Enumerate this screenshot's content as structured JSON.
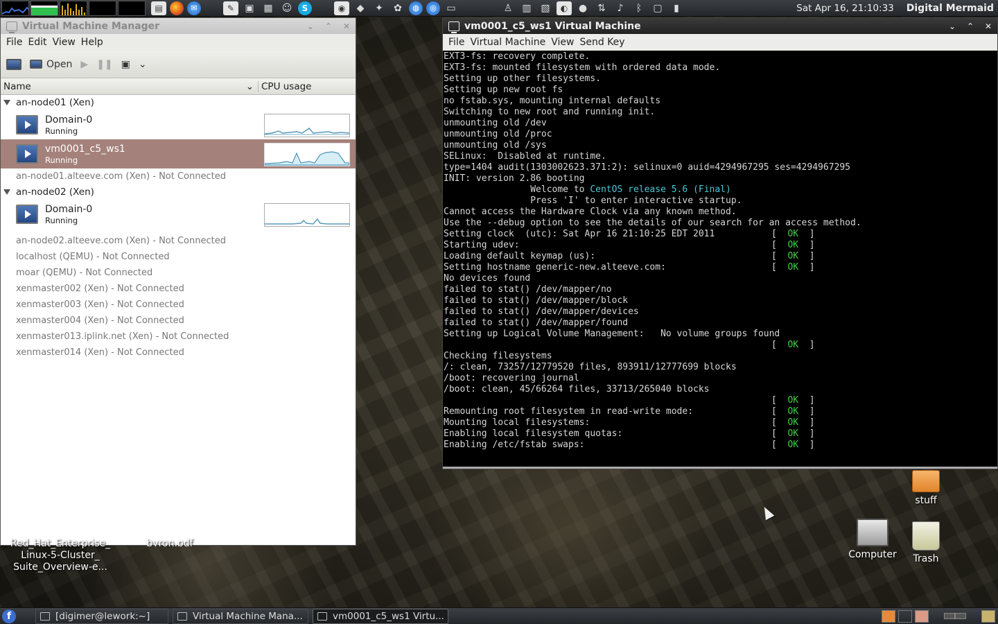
{
  "top_panel": {
    "clock": "Sat Apr 16, 21:10:33",
    "user": "Digital Mermaid",
    "launchers": [
      "terminal-icon",
      "firefox-icon",
      "thunderbird-icon",
      "text-editor-icon",
      "console-icon",
      "calculator-icon",
      "pidgin-icon",
      "skype-icon"
    ],
    "tray": [
      "volume-icon",
      "bluetooth-icon",
      "network-icon",
      "battery-icon"
    ]
  },
  "vmm": {
    "title": "Virtual Machine Manager",
    "menu": [
      "File",
      "Edit",
      "View",
      "Help"
    ],
    "toolbar": {
      "open_label": "Open"
    },
    "columns": {
      "name": "Name",
      "cpu": "CPU usage"
    },
    "hosts": [
      {
        "label": "an-node01 (Xen)",
        "vms": [
          {
            "name": "Domain-0",
            "status": "Running",
            "selected": false
          },
          {
            "name": "vm0001_c5_ws1",
            "status": "Running",
            "selected": true
          }
        ]
      },
      {
        "label": "an-node02 (Xen)",
        "vms": [
          {
            "name": "Domain-0",
            "status": "Running",
            "selected": false
          }
        ]
      }
    ],
    "conn_after_node01": "an-node01.alteeve.com (Xen) - Not Connected",
    "connections": [
      "an-node02.alteeve.com (Xen) - Not Connected",
      "localhost (QEMU) - Not Connected",
      "moar (QEMU) - Not Connected",
      "xenmaster002 (Xen) - Not Connected",
      "xenmaster003 (Xen) - Not Connected",
      "xenmaster004 (Xen) - Not Connected",
      "xenmaster013.iplink.net (Xen) - Not Connected",
      "xenmaster014 (Xen) - Not Connected"
    ]
  },
  "vm_console": {
    "title": "vm0001_c5_ws1 Virtual Machine",
    "menu": [
      "File",
      "Virtual Machine",
      "View",
      "Send Key"
    ],
    "lines": [
      "EXT3-fs: recovery complete.",
      "EXT3-fs: mounted filesystem with ordered data mode.",
      "Setting up other filesystems.",
      "Setting up new root fs",
      "no fstab.sys, mounting internal defaults",
      "Switching to new root and running init.",
      "unmounting old /dev",
      "unmounting old /proc",
      "unmounting old /sys",
      "SELinux:  Disabled at runtime.",
      "type=1404 audit(1303002623.371:2): selinux=0 auid=4294967295 ses=4294967295",
      "INIT: version 2.86 booting",
      "                Welcome to ",
      "                Press 'I' to enter interactive startup.",
      "Cannot access the Hardware Clock via any known method.",
      "Use the --debug option to see the details of our search for an access method.",
      "Setting clock  (utc): Sat Apr 16 21:10:25 EDT 2011",
      "Starting udev:",
      "Loading default keymap (us):",
      "Setting hostname generic-new.alteeve.com:",
      "No devices found",
      "failed to stat() /dev/mapper/no",
      "failed to stat() /dev/mapper/block",
      "failed to stat() /dev/mapper/devices",
      "failed to stat() /dev/mapper/found",
      "Setting up Logical Volume Management:   No volume groups found",
      "",
      "Checking filesystems",
      "/: clean, 73257/12779520 files, 893911/12777699 blocks",
      "/boot: recovering journal",
      "/boot: clean, 45/66264 files, 33713/265040 blocks",
      "",
      "Remounting root filesystem in read-write mode:",
      "Mounting local filesystems:",
      "Enabling local filesystem quotas:",
      "Enabling /etc/fstab swaps:",
      "",
      "_"
    ],
    "highlight": "CentOS release 5.6 (Final)",
    "ok_text": "OK",
    "ok_line_indices": [
      16,
      17,
      18,
      19,
      26,
      31,
      32,
      33,
      34,
      35
    ]
  },
  "desktop": {
    "icons": [
      {
        "label": "stuff",
        "icon": "folder-icon"
      },
      {
        "label": "Computer",
        "icon": "computer-icon"
      },
      {
        "label": "Trash",
        "icon": "trash-icon"
      }
    ],
    "partial_labels": [
      "Red_Hat_Enterprise_\nLinux-5-Cluster_\nSuite_Overview-e...",
      "byron.pdf"
    ]
  },
  "taskbar": {
    "tasks": [
      {
        "label": "[digimer@lework:~]",
        "active": false
      },
      {
        "label": "Virtual Machine Mana...",
        "active": false
      },
      {
        "label": "vm0001_c5_ws1 Virtu...",
        "active": true
      }
    ]
  },
  "colors": {
    "selected_row": "#a4817a",
    "ok_green": "#3fd23f",
    "centos_cyan": "#4fc6d6"
  }
}
